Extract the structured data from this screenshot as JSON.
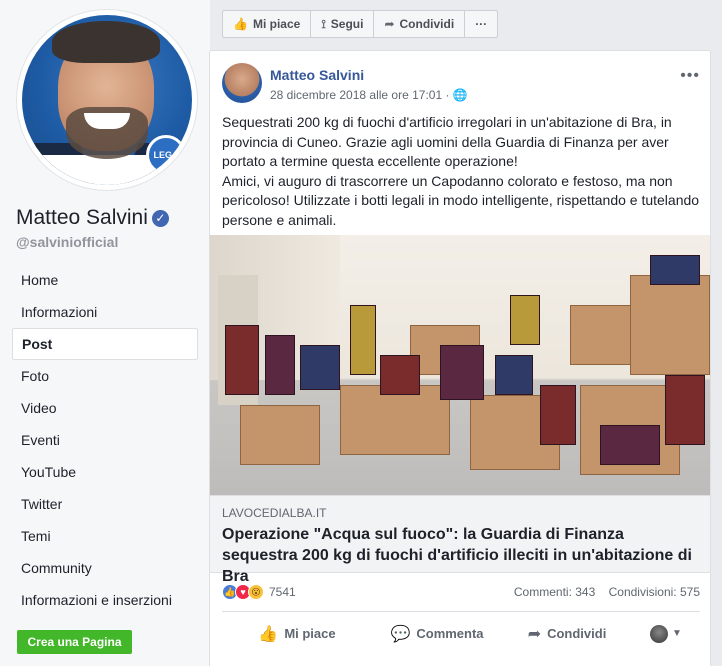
{
  "sidebar": {
    "page_name": "Matteo Salvini",
    "handle": "@salviniofficial",
    "badge_text": "LEGA",
    "nav": [
      "Home",
      "Informazioni",
      "Post",
      "Foto",
      "Video",
      "Eventi",
      "YouTube",
      "Twitter",
      "Temi",
      "Community",
      "Informazioni e inserzioni"
    ],
    "active_item": "Post",
    "create_page": "Crea una Pagina"
  },
  "top_actions": [
    {
      "label": "Mi piace",
      "icon": "thumbs-up-icon"
    },
    {
      "label": "Segui",
      "icon": "rss-icon"
    },
    {
      "label": "Condividi",
      "icon": "share-icon"
    },
    {
      "label": "···",
      "icon": "more-icon"
    }
  ],
  "post": {
    "author": "Matteo Salvini",
    "date": "28 dicembre 2018 alle ore 17:01",
    "privacy_icon": "globe-icon",
    "text_p1": "Sequestrati 200 kg di fuochi d'artificio irregolari in un'abitazione di Bra, in provincia di Cuneo. Grazie agli uomini della Guardia di Finanza per aver portato a termine questa eccellente operazione!",
    "text_p2": "Amici, vi auguro di trascorrere un Capodanno colorato e festoso, ma non pericoloso! Utilizzate i botti legali in modo intelligente, rispettando e tutelando persone e animali.",
    "link_domain": "LAVOCEDIALBA.IT",
    "link_title": "Operazione \"Acqua sul fuoco\": la Guardia di Finanza sequestra 200 kg di fuochi d'artificio illeciti in un'abitazione di Bra",
    "reaction_count": "7541",
    "comments": "Commenti: 343",
    "shares": "Condivisioni: 575",
    "actions": {
      "like": "Mi piace",
      "comment": "Commenta",
      "share": "Condividi"
    }
  },
  "colors": {
    "link_blue": "#365899",
    "create_green": "#42b72a",
    "background": "#e9ebee"
  }
}
